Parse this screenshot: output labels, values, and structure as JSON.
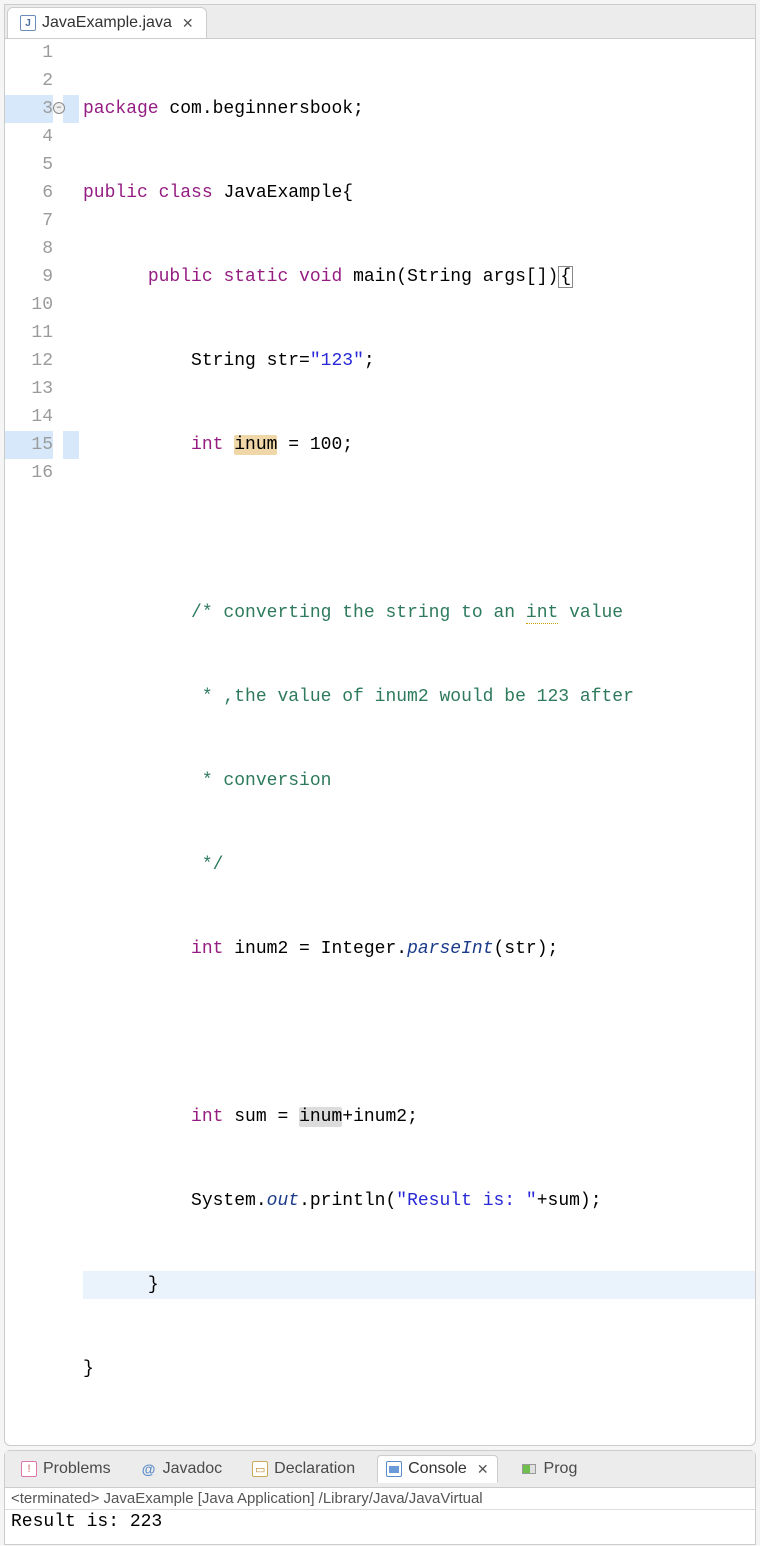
{
  "editor_tab": {
    "filename": "JavaExample.java",
    "file_icon_letter": "J",
    "close_glyph": "✕"
  },
  "gutter": {
    "lines": [
      "1",
      "2",
      "3",
      "4",
      "5",
      "6",
      "7",
      "8",
      "9",
      "10",
      "11",
      "12",
      "13",
      "14",
      "15",
      "16"
    ],
    "fold_at": 3,
    "highlight_lines": [
      3,
      15
    ],
    "current_line": 15
  },
  "code": {
    "l1_kw_package": "package",
    "l1_pkg": " com.beginnersbook;",
    "l2_kw_public": "public",
    "l2_kw_class": "class",
    "l2_classname": " JavaExample{",
    "l3_indent": "      ",
    "l3_kw_public": "public",
    "l3_kw_static": "static",
    "l3_kw_void": "void",
    "l3_main": " main(String args[])",
    "l3_brace": "{",
    "l4_indent": "          ",
    "l4_text": "String str=",
    "l4_str": "\"123\"",
    "l4_semi": ";",
    "l5_indent": "          ",
    "l5_kw_int": "int",
    "l5_sp": " ",
    "l5_var": "inum",
    "l5_rest": " = 100;",
    "l7_indent": "          ",
    "l7_com": "/* converting the string to an ",
    "l7_int": "int",
    "l7_com2": " value",
    "l8_indent": "           ",
    "l8_com": "* ,the value of inum2 would be 123 after",
    "l9_indent": "           ",
    "l9_com": "* conversion",
    "l10_indent": "           ",
    "l10_com": "*/",
    "l11_indent": "          ",
    "l11_kw_int": "int",
    "l11_text": " inum2 = Integer.",
    "l11_static": "parseInt",
    "l11_rest": "(str);",
    "l13_indent": "          ",
    "l13_kw_int": "int",
    "l13_text": " sum = ",
    "l13_var": "inum",
    "l13_rest": "+inum2;",
    "l14_indent": "          ",
    "l14_text1": "System.",
    "l14_out": "out",
    "l14_text2": ".println(",
    "l14_str": "\"Result is: \"",
    "l14_rest": "+sum);",
    "l15_indent": "      ",
    "l15_brace": "}",
    "l16_brace": "}"
  },
  "bottom_views": {
    "problems": "Problems",
    "javadoc_at": "@",
    "javadoc": "Javadoc",
    "declaration": "Declaration",
    "console": "Console",
    "console_close": "✕",
    "progress": "Prog"
  },
  "console": {
    "header": "<terminated> JavaExample [Java Application] /Library/Java/JavaVirtual",
    "output": "Result is: 223"
  }
}
